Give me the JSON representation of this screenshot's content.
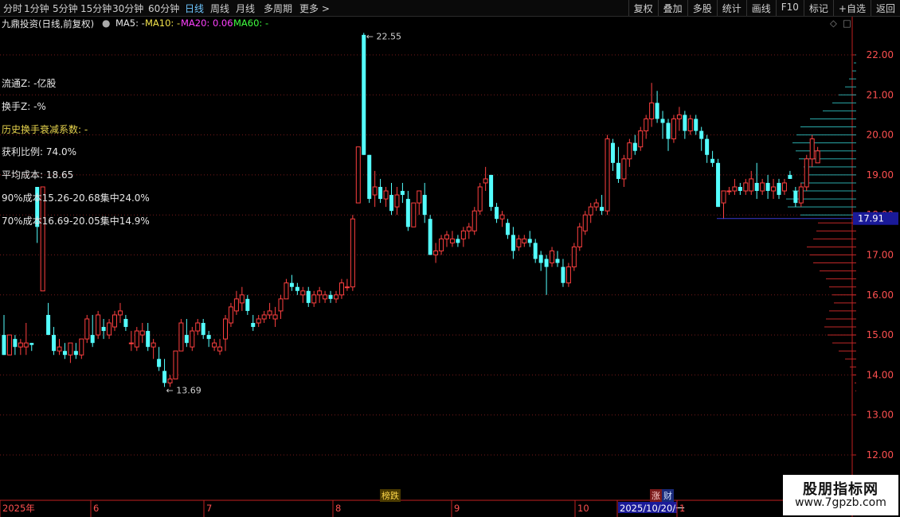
{
  "toolbar": {
    "timeframes": [
      "分时",
      "1分钟",
      "5分钟",
      "15分钟",
      "30分钟",
      "60分钟",
      "日线",
      "周线",
      "月线",
      "多周期",
      "更多 >"
    ],
    "active": "日线",
    "buttons": [
      "复权",
      "叠加",
      "多股",
      "统计",
      "画线",
      "F10",
      "标记",
      "+自选",
      "返回"
    ]
  },
  "info": {
    "stock_title": "九鼎投资(日线,前复权)",
    "ma5": "MA5: -",
    "ma10": "MA10: -",
    "ma20": "MA20: 0.06",
    "ma60": "MA60: -"
  },
  "side_panel": {
    "float_shares": "流通Z: -亿股",
    "turnover": "换手Z: -%",
    "decay": "历史换手衰减系数: -",
    "profit_ratio": "获利比例: 74.0%",
    "avg_cost": "平均成本: 18.65",
    "cost90": "90%成本15.26-20.68集中24.0%",
    "cost70": "70%成本16.69-20.05集中14.9%"
  },
  "events": {
    "ev1": "榜跌",
    "ev2": "涨",
    "ev3": "财"
  },
  "watermark": {
    "title": "股朋指标网",
    "url": "www.7gpzb.com"
  },
  "colors": {
    "up": "#ff4040",
    "down": "#54ffff",
    "grid": "#7a1a1a",
    "axis": "#c02020",
    "price_label_bg": "#1a1a99"
  },
  "chart_data": {
    "type": "candlestick",
    "y_ticks": [
      12.0,
      13.0,
      14.0,
      15.0,
      16.0,
      17.0,
      18.0,
      19.0,
      20.0,
      21.0,
      22.0
    ],
    "ylim": [
      11.6,
      22.7
    ],
    "high_label": "22.55",
    "low_label": "13.69",
    "current_price": "17.91",
    "x_labels": [
      "2025年",
      "6",
      "7",
      "8",
      "9",
      "10",
      "2025/10/20/一",
      "1"
    ],
    "ohlc": [
      [
        15.0,
        15.5,
        14.5,
        14.5
      ],
      [
        14.5,
        15.0,
        14.5,
        15.0
      ],
      [
        14.9,
        15.0,
        14.5,
        14.7
      ],
      [
        14.7,
        14.9,
        14.5,
        14.8
      ],
      [
        14.7,
        15.3,
        14.5,
        14.8
      ],
      [
        14.8,
        14.8,
        14.6,
        14.75
      ],
      [
        18.7,
        18.7,
        17.3,
        17.7
      ],
      [
        16.1,
        18.7,
        16.1,
        18.7
      ],
      [
        15.5,
        15.8,
        15.0,
        15.0
      ],
      [
        15.0,
        15.2,
        14.5,
        14.6
      ],
      [
        14.6,
        14.9,
        14.5,
        14.7
      ],
      [
        14.6,
        14.8,
        14.4,
        14.5
      ],
      [
        14.5,
        14.8,
        14.3,
        14.8
      ],
      [
        14.6,
        14.8,
        14.4,
        14.5
      ],
      [
        14.5,
        14.9,
        14.4,
        14.9
      ],
      [
        14.9,
        15.5,
        14.8,
        15.4
      ],
      [
        15.0,
        15.5,
        14.7,
        14.8
      ],
      [
        15.0,
        15.6,
        14.9,
        15.5
      ],
      [
        15.2,
        15.4,
        14.9,
        15.1
      ],
      [
        15.0,
        15.4,
        14.9,
        15.3
      ],
      [
        15.2,
        15.6,
        15.1,
        15.5
      ],
      [
        15.5,
        15.8,
        15.3,
        15.6
      ],
      [
        15.4,
        15.5,
        15.1,
        15.2
      ],
      [
        14.8,
        15.1,
        14.6,
        14.8
      ],
      [
        14.7,
        15.2,
        14.6,
        15.1
      ],
      [
        15.0,
        15.3,
        14.8,
        15.1
      ],
      [
        15.1,
        15.3,
        14.6,
        14.7
      ],
      [
        14.7,
        14.9,
        14.4,
        14.8
      ],
      [
        14.4,
        14.7,
        14.1,
        14.2
      ],
      [
        14.1,
        14.4,
        13.7,
        13.8
      ],
      [
        13.8,
        14.0,
        13.7,
        13.9
      ],
      [
        13.9,
        14.6,
        13.9,
        14.6
      ],
      [
        14.6,
        15.4,
        14.6,
        15.3
      ],
      [
        15.0,
        15.4,
        14.7,
        14.8
      ],
      [
        14.7,
        15.2,
        14.6,
        15.1
      ],
      [
        15.1,
        15.4,
        15.0,
        15.3
      ],
      [
        15.3,
        15.4,
        14.9,
        15.0
      ],
      [
        15.0,
        15.1,
        14.7,
        14.9
      ],
      [
        14.7,
        14.9,
        14.6,
        14.8
      ],
      [
        14.6,
        14.9,
        14.5,
        14.7
      ],
      [
        14.9,
        15.5,
        14.6,
        15.4
      ],
      [
        15.3,
        15.8,
        15.2,
        15.7
      ],
      [
        15.6,
        16.1,
        15.5,
        15.9
      ],
      [
        15.8,
        16.2,
        15.6,
        16.0
      ],
      [
        15.9,
        16.0,
        15.5,
        15.6
      ],
      [
        15.3,
        15.5,
        15.1,
        15.2
      ],
      [
        15.3,
        15.5,
        15.2,
        15.4
      ],
      [
        15.4,
        15.6,
        15.3,
        15.5
      ],
      [
        15.5,
        15.8,
        15.4,
        15.6
      ],
      [
        15.4,
        15.7,
        15.2,
        15.5
      ],
      [
        15.6,
        16.0,
        15.4,
        15.9
      ],
      [
        15.9,
        16.4,
        15.9,
        16.3
      ],
      [
        16.3,
        16.5,
        16.1,
        16.2
      ],
      [
        16.2,
        16.3,
        16.0,
        16.1
      ],
      [
        16.0,
        16.2,
        15.8,
        16.1
      ],
      [
        16.1,
        16.2,
        15.7,
        15.8
      ],
      [
        15.8,
        16.1,
        15.7,
        16.0
      ],
      [
        16.0,
        16.2,
        15.8,
        16.1
      ],
      [
        15.9,
        16.1,
        15.8,
        16.0
      ],
      [
        16.0,
        16.1,
        15.8,
        15.9
      ],
      [
        15.9,
        16.1,
        15.8,
        16.0
      ],
      [
        16.0,
        16.4,
        15.9,
        16.3
      ],
      [
        16.2,
        16.4,
        16.1,
        16.2
      ],
      [
        16.2,
        18.0,
        16.1,
        17.9
      ],
      [
        18.3,
        19.7,
        18.3,
        19.7
      ],
      [
        22.5,
        22.55,
        19.5,
        19.5
      ],
      [
        19.5,
        19.5,
        18.3,
        18.4
      ],
      [
        18.5,
        19.1,
        18.2,
        18.7
      ],
      [
        18.7,
        18.9,
        18.3,
        18.4
      ],
      [
        18.4,
        18.7,
        18.2,
        18.6
      ],
      [
        18.5,
        18.8,
        18.0,
        18.1
      ],
      [
        18.2,
        18.7,
        18.0,
        18.5
      ],
      [
        18.6,
        18.8,
        18.3,
        18.5
      ],
      [
        18.4,
        18.6,
        17.6,
        17.7
      ],
      [
        17.7,
        18.3,
        17.7,
        18.3
      ],
      [
        18.3,
        18.6,
        18.0,
        18.6
      ],
      [
        18.5,
        18.8,
        17.8,
        18.0
      ],
      [
        17.9,
        18.0,
        17.0,
        17.0
      ],
      [
        17.0,
        17.3,
        16.8,
        17.1
      ],
      [
        17.1,
        17.5,
        17.0,
        17.4
      ],
      [
        17.4,
        17.6,
        17.2,
        17.5
      ],
      [
        17.3,
        17.6,
        17.2,
        17.4
      ],
      [
        17.4,
        17.5,
        17.2,
        17.3
      ],
      [
        17.4,
        17.7,
        17.2,
        17.6
      ],
      [
        17.6,
        17.8,
        17.4,
        17.7
      ],
      [
        17.6,
        18.2,
        17.5,
        18.1
      ],
      [
        18.1,
        18.8,
        18.0,
        18.7
      ],
      [
        18.8,
        19.2,
        18.6,
        18.9
      ],
      [
        19.0,
        19.0,
        18.1,
        18.2
      ],
      [
        18.2,
        18.3,
        17.8,
        17.9
      ],
      [
        17.9,
        18.1,
        17.7,
        18.0
      ],
      [
        17.8,
        17.9,
        17.4,
        17.5
      ],
      [
        17.5,
        17.7,
        16.9,
        17.1
      ],
      [
        17.2,
        17.5,
        17.1,
        17.4
      ],
      [
        17.3,
        17.5,
        17.2,
        17.4
      ],
      [
        17.4,
        17.6,
        17.2,
        17.3
      ],
      [
        17.3,
        17.4,
        16.8,
        16.9
      ],
      [
        17.0,
        17.1,
        16.6,
        16.8
      ],
      [
        16.9,
        17.0,
        16.0,
        16.7
      ],
      [
        16.8,
        17.2,
        16.7,
        17.1
      ],
      [
        16.9,
        17.1,
        16.7,
        16.8
      ],
      [
        16.7,
        16.9,
        16.2,
        16.3
      ],
      [
        16.3,
        16.8,
        16.2,
        16.7
      ],
      [
        16.7,
        17.3,
        16.6,
        17.2
      ],
      [
        17.2,
        17.8,
        17.1,
        17.7
      ],
      [
        17.6,
        18.1,
        17.5,
        18.0
      ],
      [
        18.0,
        18.3,
        17.8,
        18.2
      ],
      [
        18.2,
        18.4,
        18.1,
        18.3
      ],
      [
        18.2,
        18.5,
        18.0,
        18.1
      ],
      [
        18.1,
        20.0,
        18.0,
        19.9
      ],
      [
        19.8,
        19.9,
        19.1,
        19.3
      ],
      [
        19.3,
        19.7,
        18.8,
        18.9
      ],
      [
        18.9,
        19.5,
        18.7,
        19.4
      ],
      [
        19.4,
        19.9,
        19.2,
        19.8
      ],
      [
        19.8,
        20.0,
        19.5,
        19.6
      ],
      [
        19.7,
        20.2,
        19.6,
        20.1
      ],
      [
        20.1,
        20.5,
        19.9,
        20.4
      ],
      [
        20.4,
        21.3,
        20.2,
        20.8
      ],
      [
        20.8,
        21.1,
        20.3,
        20.4
      ],
      [
        20.4,
        20.6,
        19.9,
        20.3
      ],
      [
        20.3,
        20.4,
        19.6,
        19.9
      ],
      [
        19.9,
        20.5,
        19.8,
        20.4
      ],
      [
        20.4,
        20.7,
        20.1,
        20.5
      ],
      [
        20.5,
        20.6,
        19.9,
        20.1
      ],
      [
        20.1,
        20.5,
        20.0,
        20.4
      ],
      [
        20.4,
        20.5,
        20.0,
        20.1
      ],
      [
        20.1,
        20.2,
        19.6,
        19.9
      ],
      [
        19.9,
        20.0,
        19.3,
        19.5
      ],
      [
        19.4,
        19.6,
        19.2,
        19.3
      ],
      [
        19.3,
        19.4,
        18.2,
        18.2
      ],
      [
        18.3,
        18.6,
        17.9,
        18.6
      ],
      [
        18.6,
        18.7,
        18.5,
        18.6
      ],
      [
        18.6,
        18.9,
        18.5,
        18.7
      ],
      [
        18.7,
        18.8,
        18.5,
        18.6
      ],
      [
        18.6,
        18.9,
        18.5,
        18.8
      ],
      [
        18.6,
        19.1,
        18.5,
        18.9
      ],
      [
        18.8,
        19.3,
        18.4,
        18.6
      ],
      [
        18.6,
        18.9,
        18.5,
        18.8
      ],
      [
        18.8,
        19.0,
        18.4,
        18.6
      ],
      [
        18.6,
        18.9,
        18.4,
        18.7
      ],
      [
        18.8,
        18.9,
        18.4,
        18.5
      ],
      [
        18.6,
        18.9,
        18.5,
        18.8
      ],
      [
        19.0,
        19.1,
        18.9,
        18.9
      ],
      [
        18.6,
        18.7,
        18.2,
        18.3
      ],
      [
        18.3,
        18.8,
        18.2,
        18.7
      ],
      [
        18.7,
        19.5,
        18.6,
        19.4
      ],
      [
        19.4,
        20.0,
        19.2,
        19.9
      ],
      [
        19.3,
        19.7,
        19.3,
        19.6
      ]
    ],
    "chip_distribution": [
      [
        22.0,
        1
      ],
      [
        21.8,
        3
      ],
      [
        21.6,
        5
      ],
      [
        21.4,
        9
      ],
      [
        21.2,
        14
      ],
      [
        21.0,
        22
      ],
      [
        20.8,
        30
      ],
      [
        20.6,
        42
      ],
      [
        20.4,
        58
      ],
      [
        20.2,
        70
      ],
      [
        20.0,
        75
      ],
      [
        19.8,
        80
      ],
      [
        19.6,
        76
      ],
      [
        19.4,
        72
      ],
      [
        19.2,
        66
      ],
      [
        19.0,
        64
      ],
      [
        18.8,
        70
      ],
      [
        18.6,
        80
      ],
      [
        18.4,
        88
      ],
      [
        18.2,
        86
      ],
      [
        18.0,
        70
      ],
      [
        17.8,
        48
      ],
      [
        17.6,
        50
      ],
      [
        17.4,
        54
      ],
      [
        17.2,
        62
      ],
      [
        17.0,
        58
      ],
      [
        16.8,
        54
      ],
      [
        16.6,
        46
      ],
      [
        16.4,
        38
      ],
      [
        16.2,
        34
      ],
      [
        16.0,
        30
      ],
      [
        15.8,
        28
      ],
      [
        15.6,
        34
      ],
      [
        15.4,
        38
      ],
      [
        15.2,
        40
      ],
      [
        15.0,
        36
      ],
      [
        14.8,
        30
      ],
      [
        14.6,
        22
      ],
      [
        14.4,
        14
      ],
      [
        14.2,
        8
      ],
      [
        14.0,
        4
      ],
      [
        13.8,
        2
      ],
      [
        13.6,
        1
      ],
      [
        13.0,
        1
      ]
    ]
  }
}
